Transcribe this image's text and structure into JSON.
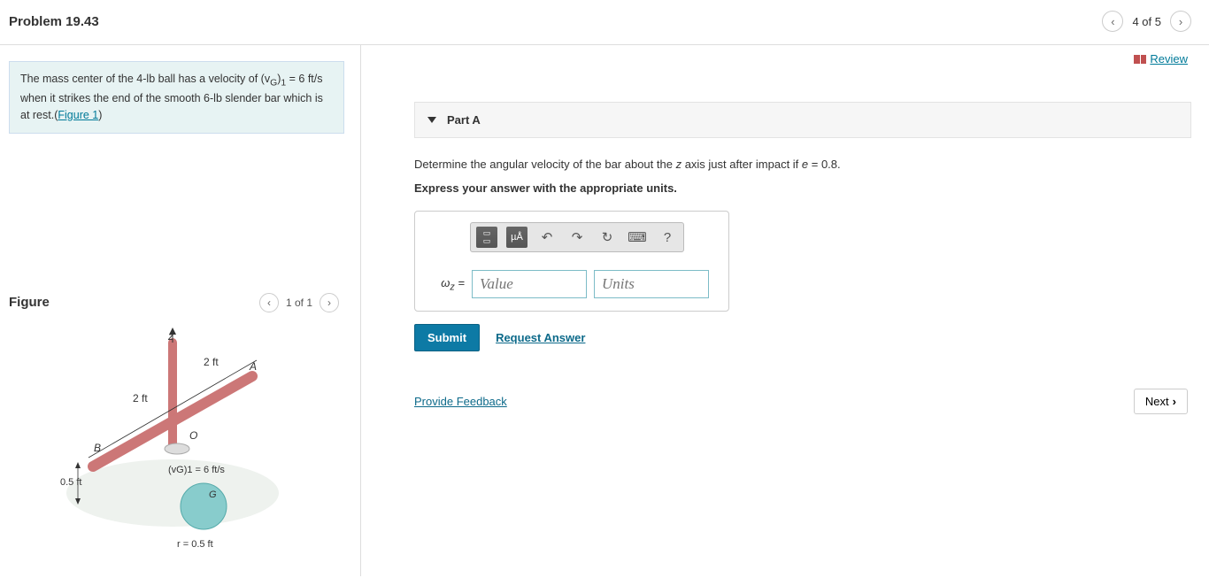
{
  "header": {
    "title": "Problem 19.43",
    "page_indicator": "4 of 5"
  },
  "review_label": "Review",
  "problem_statement": {
    "text_pre": "The mass center of the 4-lb ball has a velocity of (v",
    "sub1": "G",
    "text_mid": ")",
    "sub2": "1",
    "text_post": " = 6 ft/s when it strikes the end of the smooth 6-lb slender bar which is at rest.(",
    "figure_link": "Figure 1",
    "close": ")"
  },
  "figure": {
    "title": "Figure",
    "nav": "1 of 1",
    "labels": {
      "z": "z",
      "seg_left": "2 ft",
      "seg_right": "2 ft",
      "A": "A",
      "B": "B",
      "O": "O",
      "G": "G",
      "offset": "0.5 ft",
      "vg": "(vG)1 = 6 ft/s",
      "radius": "r = 0.5 ft"
    }
  },
  "part": {
    "title": "Part A",
    "instruction1": "Determine the angular velocity of the bar about the z axis just after impact if e = 0.8.",
    "instruction2": "Express your answer with the appropriate units.",
    "toolbar": {
      "template": "▭/▭",
      "unit": "µÅ",
      "undo": "↶",
      "redo": "↷",
      "reset": "↻",
      "keyboard": "⌨",
      "help": "?"
    },
    "label": "ωz =",
    "value_placeholder": "Value",
    "units_placeholder": "Units",
    "submit": "Submit",
    "request": "Request Answer"
  },
  "footer": {
    "feedback": "Provide Feedback",
    "next": "Next"
  }
}
